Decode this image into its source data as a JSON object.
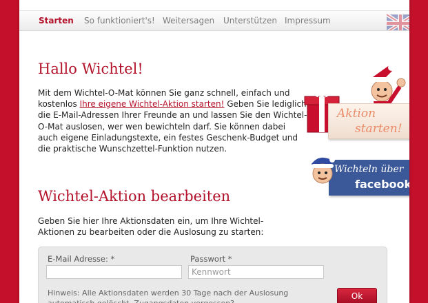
{
  "nav": {
    "items": [
      {
        "label": "Starten",
        "active": true
      },
      {
        "label": "So funktioniert's!",
        "active": false
      },
      {
        "label": "Weitersagen",
        "active": false
      },
      {
        "label": "Unterstützen",
        "active": false
      },
      {
        "label": "Impressum",
        "active": false
      }
    ],
    "language_icon": "uk-flag-icon"
  },
  "intro": {
    "heading": "Hallo Wichtel!",
    "text_before_link": "Mit dem Wichtel-O-Mat können Sie ganz schnell, einfach und kostenlos ",
    "link": "Ihre eigene Wichtel-Aktion starten!",
    "text_after_link": " Geben Sie lediglich die E-Mail-Adressen Ihrer Freunde an und lassen Sie den Wichtel-O-Mat auslosen, wer wen bewichteln darf. Sie können dabei auch eigene Einladungstexte, ein festes Geschenk-Budget und die praktische Wunschzettel-Funktion nutzen."
  },
  "promo": {
    "start_line1": "Aktion",
    "start_line2": "starten!",
    "facebook_line1": "Wichteln über",
    "facebook_line2": "facebook"
  },
  "edit": {
    "heading": "Wichtel-Aktion bearbeiten",
    "text": "Geben Sie hier Ihre Aktionsdaten ein, um Ihre Wichtel-Aktionen zu bearbeiten oder die Auslosung zu starten:",
    "email_label": "E-Mail Adresse: *",
    "email_value": "",
    "password_label": "Passwort *",
    "password_placeholder": "Kennwort",
    "hint": "Hinweis: Alle Aktionsdaten werden 30 Tage nach der Auslosung automatisch gelöscht. Zugangsdaten vergessen?",
    "ok_label": "Ok"
  },
  "colors": {
    "brand_red": "#c4102a",
    "heading_red": "#b3122b",
    "facebook_blue": "#3b5998"
  }
}
